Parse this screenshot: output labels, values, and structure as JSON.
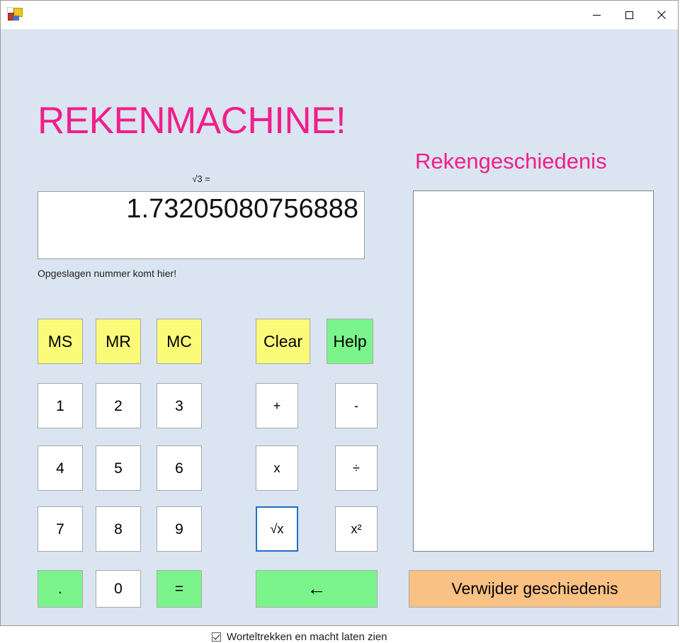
{
  "window": {
    "icon_name": "app-icon",
    "minimize_label": "–",
    "maximize_label": "□",
    "close_label": "✕"
  },
  "app": {
    "title": "REKENMACHINE!",
    "accent_color": "#f01f8a",
    "background_color": "#dbe4f1"
  },
  "display": {
    "equation_label": "√3 =",
    "value": "1.73205080756888",
    "memory_hint": "Opgeslagen nummer komt hier!"
  },
  "memory_buttons": [
    {
      "label": "MS",
      "color": "#fbfb7a"
    },
    {
      "label": "MR",
      "color": "#fbfb7a"
    },
    {
      "label": "MC",
      "color": "#fbfb7a"
    }
  ],
  "action_buttons": {
    "clear": "Clear",
    "help": "Help"
  },
  "keypad": {
    "row1": [
      "1",
      "2",
      "3"
    ],
    "row2": [
      "4",
      "5",
      "6"
    ],
    "row3": [
      "7",
      "8",
      "9"
    ],
    "row4": [
      ".",
      "0",
      "="
    ]
  },
  "operators": {
    "plus": "+",
    "minus": "-",
    "multiply": "x",
    "divide": "÷",
    "sqrt": "√x",
    "square": "x²"
  },
  "backspace": {
    "label": "←"
  },
  "history": {
    "title": "Rekengeschiedenis",
    "items": [],
    "delete_label": "Verwijder geschiedenis"
  },
  "options": {
    "sqrt_power_checkbox_label": "Worteltrekken en macht laten zien",
    "sqrt_power_checked": true
  }
}
